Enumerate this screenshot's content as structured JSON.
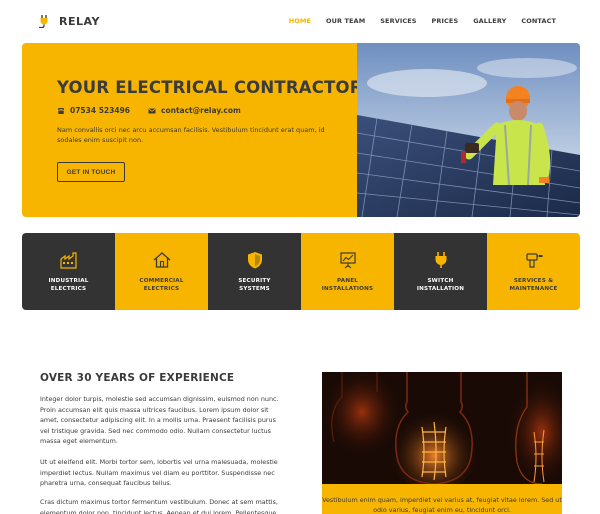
{
  "brand": {
    "name": "RELAY",
    "accent": "#f7b500",
    "dark": "#333333"
  },
  "nav": [
    {
      "label": "HOME",
      "active": true
    },
    {
      "label": "OUR TEAM",
      "active": false
    },
    {
      "label": "SERVICES",
      "active": false
    },
    {
      "label": "PRICES",
      "active": false
    },
    {
      "label": "GALLERY",
      "active": false
    },
    {
      "label": "CONTACT",
      "active": false
    }
  ],
  "hero": {
    "title": "YOUR ELECTRICAL CONTRACTOR",
    "phone": "07534 523496",
    "email": "contact@relay.com",
    "text": "Nam convallis orci nec arcu accumsan facilisis. Vestibulum tincidunt erat quam, id sodales enim suscipit non.",
    "button": "GET IN TOUCH",
    "image": "electrician-installing-solar-panels"
  },
  "services": [
    {
      "label": "INDUSTRIAL\nELECTRICS",
      "icon": "factory-icon",
      "theme": "dark"
    },
    {
      "label": "COMMERCIAL\nELECTRICS",
      "icon": "house-icon",
      "theme": "yellow"
    },
    {
      "label": "SECURITY\nSYSTEMS",
      "icon": "shield-icon",
      "theme": "dark"
    },
    {
      "label": "PANEL\nINSTALLATIONS",
      "icon": "panel-chart-icon",
      "theme": "yellow"
    },
    {
      "label": "SWITCH\nINSTALLATION",
      "icon": "plug-icon",
      "theme": "dark"
    },
    {
      "label": "SERVICES &\nMAINTENANCE",
      "icon": "drill-icon",
      "theme": "yellow"
    }
  ],
  "experience": {
    "title": "OVER 30 YEARS OF EXPERIENCE",
    "p1": "Integer dolor turpis, molestie sed accumsan dignissim, euismod non nunc. Proin accumsan elit quis massa ultrices faucibus. Lorem ipsum dolor sit amet, consectetur adipiscing elit. In a mollis urna. Praesent facilisis purus vel tristique gravida. Sed nec commodo odio. Nullam consectetur luctus massa eget elementum.",
    "p2": "Ut ut eleifend elit. Morbi tortor sem, lobortis vel urna malesuada, molestie imperdiet lectus. Nullam maximus vel diam eu porttitor. Suspendisse nec pharetra urna, consequat faucibus tellus.",
    "p3": "Cras dictum maximus tortor fermentum vestibulum. Donec at sem mattis, elementum dolor non, tincidunt lectus. Aenean et dui lorem. Pellentesque",
    "image": "filament-light-bulbs",
    "caption": "Vestibulum enim quam, imperdiet vel varius at, feugiat vitae lorem. Sed ut odio varius, feugiat enim eu, tincidunt orci."
  }
}
